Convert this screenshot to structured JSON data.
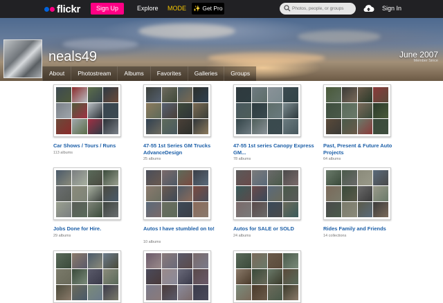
{
  "nav": {
    "logo_text": "flickr",
    "signup_label": "Sign Up",
    "explore_label": "Explore",
    "mode_label": "MODE",
    "getpro_label": "Get Pro",
    "search_placeholder": "Photos, people, or groups",
    "signin_label": "Sign In"
  },
  "colors": {
    "brand_blue": "#0063dc",
    "brand_pink": "#ff0084",
    "mode_yellow": "#f7c700",
    "link_blue": "#1c5fa8"
  },
  "profile": {
    "username": "neals49",
    "joined_date": "June 2007",
    "joined_label": "Member Since"
  },
  "tabs": [
    {
      "label": "About"
    },
    {
      "label": "Photostream"
    },
    {
      "label": "Albums"
    },
    {
      "label": "Favorites"
    },
    {
      "label": "Galleries"
    },
    {
      "label": "Groups"
    }
  ],
  "collections": [
    {
      "title": "Car Shows / Tours / Runs",
      "count": "113 albums"
    },
    {
      "title": "47-55 1st Series GM Trucks AdvanceDesign",
      "count": "25 albums"
    },
    {
      "title": "47-55 1st series Canopy Express GM...",
      "count": "78 albums"
    },
    {
      "title": "Past, Present & Future Auto Projects",
      "count": "64 albums"
    },
    {
      "title": "Jobs Done for Hire.",
      "count": "29 albums"
    },
    {
      "title": "Autos I have stumbled on to!",
      "count": "10 albums"
    },
    {
      "title": "Autos for SALE or SOLD",
      "count": "24 albums"
    },
    {
      "title": "Rides Family and Friends",
      "count": "14 collections"
    },
    {
      "title": "",
      "count": ""
    },
    {
      "title": "",
      "count": ""
    },
    {
      "title": "",
      "count": ""
    }
  ]
}
